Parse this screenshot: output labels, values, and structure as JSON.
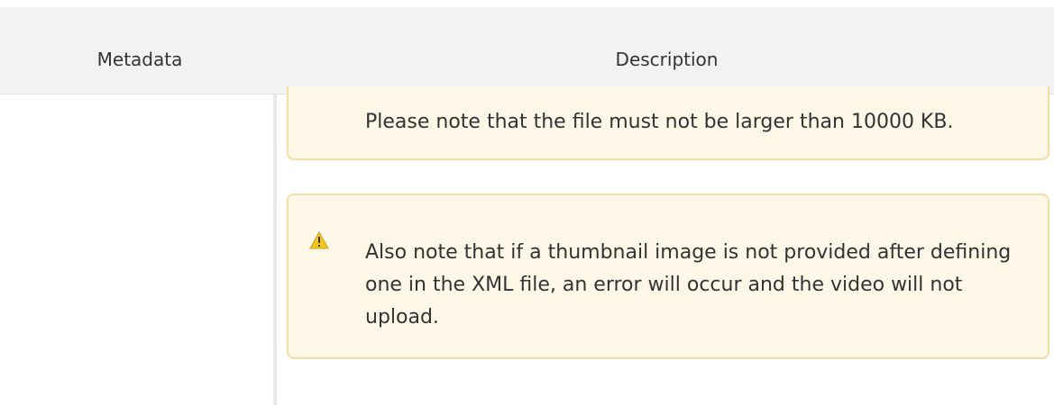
{
  "table": {
    "headers": {
      "metadata": "Metadata",
      "description": "Description"
    }
  },
  "notes": [
    {
      "icon": "warning-icon",
      "text": "Please note that the file must not be larger than 10000 KB."
    },
    {
      "icon": "warning-icon",
      "text": "Also note that if a thumbnail image is not provided after defining one in the XML file, an error will occur and the video will not upload."
    }
  ],
  "colors": {
    "header_bg": "#f2f2f2",
    "note_bg": "#fdf7e8",
    "note_border": "#f3dda8",
    "warning_fill": "#f5c518",
    "text": "#333333"
  }
}
